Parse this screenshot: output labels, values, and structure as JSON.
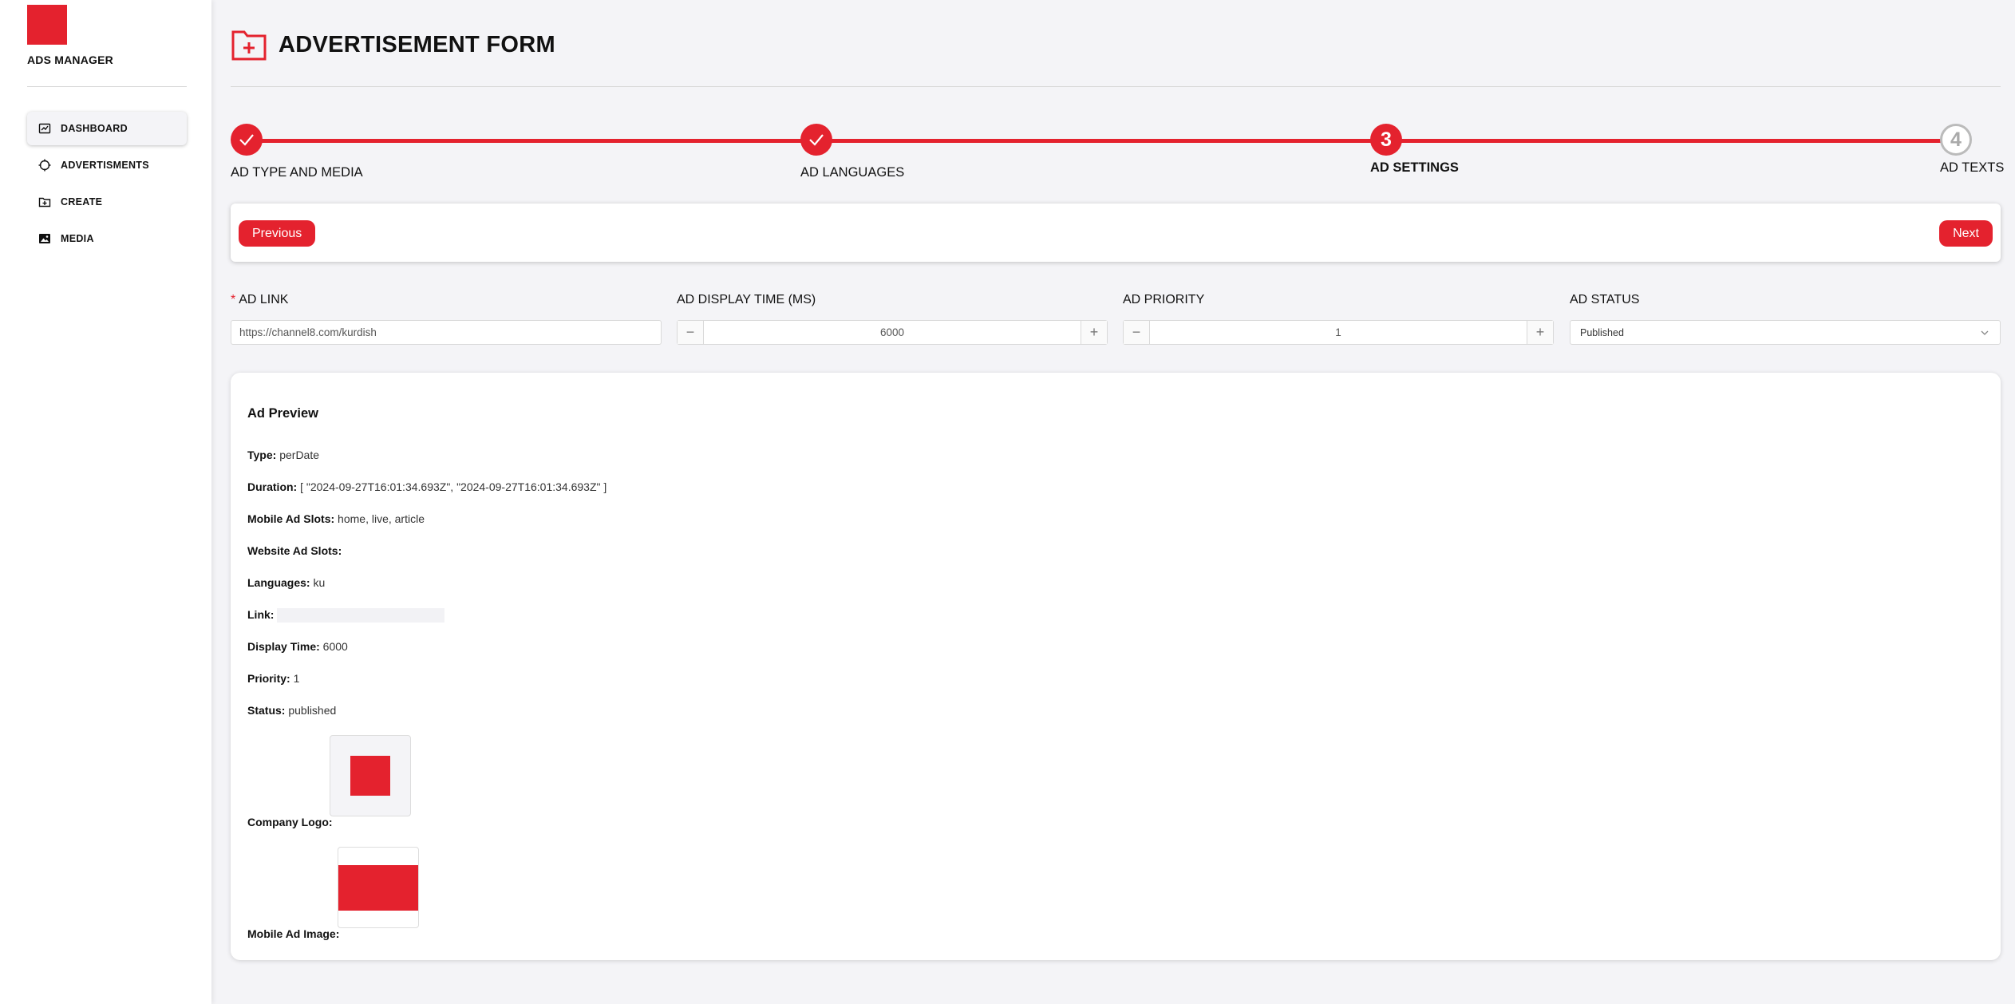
{
  "sidebar": {
    "app_name": "ADS MANAGER",
    "items": [
      {
        "label": "DASHBOARD",
        "icon": "dashboard-icon"
      },
      {
        "label": "ADVERTISMENTS",
        "icon": "crosshair-icon"
      },
      {
        "label": "CREATE",
        "icon": "folder-plus-icon"
      },
      {
        "label": "MEDIA",
        "icon": "image-icon"
      }
    ]
  },
  "header": {
    "title": "ADVERTISEMENT FORM",
    "icon": "folder-plus-icon"
  },
  "stepper": {
    "steps": [
      {
        "label": "AD TYPE AND MEDIA",
        "status": "done"
      },
      {
        "label": "AD LANGUAGES",
        "status": "done"
      },
      {
        "number": "3",
        "label": "AD SETTINGS",
        "status": "current"
      },
      {
        "number": "4",
        "label": "AD TEXTS",
        "status": "pending"
      }
    ]
  },
  "nav_buttons": {
    "previous": "Previous",
    "next": "Next"
  },
  "form": {
    "ad_link": {
      "required_mark": "*",
      "label": "AD LINK",
      "value": "https://channel8.com/kurdish"
    },
    "display_time": {
      "label": "AD DISPLAY TIME (MS)",
      "value": "6000"
    },
    "priority": {
      "label": "AD PRIORITY",
      "value": "1"
    },
    "status": {
      "label": "AD STATUS",
      "value": "Published"
    }
  },
  "preview": {
    "title": "Ad Preview",
    "type": {
      "label": "Type:",
      "value": "perDate"
    },
    "duration": {
      "label": "Duration:",
      "value": "[ \"2024-09-27T16:01:34.693Z\", \"2024-09-27T16:01:34.693Z\" ]"
    },
    "mobile_slots": {
      "label": "Mobile Ad Slots:",
      "value": "home, live, article"
    },
    "website_slots": {
      "label": "Website Ad Slots:",
      "value": ""
    },
    "languages": {
      "label": "Languages:",
      "value": "ku"
    },
    "link": {
      "label": "Link:",
      "value": ""
    },
    "display_time": {
      "label": "Display Time:",
      "value": "6000"
    },
    "priority": {
      "label": "Priority:",
      "value": "1"
    },
    "status": {
      "label": "Status:",
      "value": "published"
    },
    "company_logo": {
      "label": "Company Logo:"
    },
    "mobile_image": {
      "label": "Mobile Ad Image:"
    }
  },
  "colors": {
    "accent": "#e4222e",
    "background": "#f4f4f7",
    "pending_step": "#bbbbbb"
  }
}
